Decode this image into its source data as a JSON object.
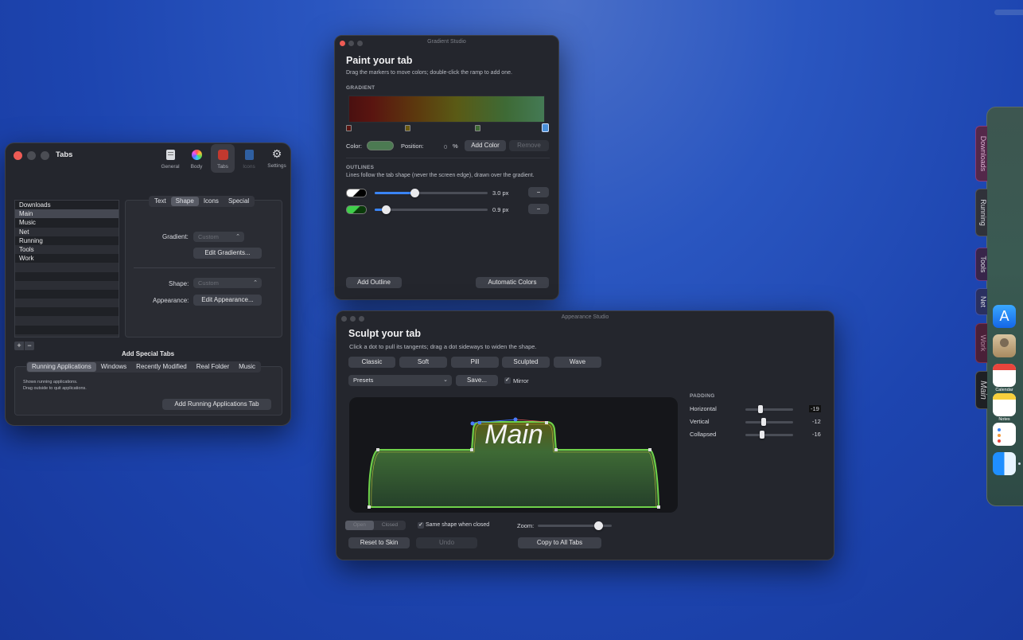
{
  "tabs_window": {
    "title": "Tabs",
    "toolbar": [
      {
        "label": "General",
        "icon": "general-icon"
      },
      {
        "label": "Body",
        "icon": "color-wheel-icon"
      },
      {
        "label": "Tabs",
        "icon": "tabs-icon"
      },
      {
        "label": "Icons",
        "icon": "icons-icon"
      },
      {
        "label": "Settings",
        "icon": "gear-icon"
      }
    ],
    "tab_list": [
      "Downloads",
      "Main",
      "Music",
      "Net",
      "Running",
      "Tools",
      "Work"
    ],
    "segments": [
      "Text",
      "Shape",
      "Icons",
      "Special"
    ],
    "gradient_label": "Gradient:",
    "gradient_value": "Custom",
    "edit_gradients": "Edit Gradients...",
    "shape_label": "Shape:",
    "shape_value": "Custom",
    "appearance_label": "Appearance:",
    "edit_appearance": "Edit Appearance...",
    "plus": "+",
    "minus": "−",
    "add_special_title": "Add Special Tabs",
    "special_segments": [
      "Running Applications",
      "Windows",
      "Recently Modified",
      "Real Folder",
      "Music"
    ],
    "special_desc_1": "Shows running applications.",
    "special_desc_2": "Drag outside to quit applications.",
    "add_running_button": "Add Running Applications Tab"
  },
  "gradient_window": {
    "title": "Gradient Studio",
    "heading": "Paint your tab",
    "subtitle": "Drag the markers to move colors; double-click the ramp to add one.",
    "gradient_label": "GRADIENT",
    "color_label": "Color:",
    "position_label": "Position:",
    "position_value": "0",
    "percent": "%",
    "add_color": "Add Color",
    "remove": "Remove",
    "outlines_label": "OUTLINES",
    "outlines_desc": "Lines follow the tab shape (never the screen edge), drawn over the gradient.",
    "outlines": [
      {
        "value": "3.0 px",
        "level": 0.35
      },
      {
        "value": "0.9 px",
        "level": 0.1
      }
    ],
    "remove_symbol": "−",
    "add_outline": "Add Outline",
    "automatic_colors": "Automatic Colors",
    "colors": {
      "stop_red": "#5a1512",
      "stop_olive": "#6b5a10",
      "stop_green": "#3f6a35",
      "stop_blue": "#4a8fd8"
    }
  },
  "appearance_window": {
    "title": "Appearance Studio",
    "heading": "Sculpt your tab",
    "subtitle": "Click a dot to pull its tangents; drag a dot sideways to widen the shape.",
    "shapes": [
      "Classic",
      "Soft",
      "Pill",
      "Sculpted",
      "Wave"
    ],
    "presets": "Presets",
    "save": "Save...",
    "mirror": "Mirror",
    "preview_text": "Main",
    "padding_label": "PADDING",
    "padding": [
      {
        "label": "Horizontal",
        "value": "-19",
        "level": 0.32
      },
      {
        "label": "Vertical",
        "value": "-12",
        "level": 0.38
      },
      {
        "label": "Collapsed",
        "value": "-16",
        "level": 0.35
      }
    ],
    "state_segments": [
      "Open",
      "Closed"
    ],
    "same_shape": "Same shape when closed",
    "zoom_label": "Zoom:",
    "zoom_level": 0.82,
    "reset": "Reset to Skin",
    "undo": "Undo",
    "copy_all": "Copy to All Tabs"
  },
  "dock": {
    "tabs": [
      "Downloads",
      "Running",
      "Tools",
      "Net",
      "Work",
      "Main"
    ],
    "apps": [
      {
        "label": "",
        "icon": "app-store-icon"
      },
      {
        "label": "",
        "icon": "contacts-icon"
      },
      {
        "label": "Calendar",
        "icon": "calendar-icon"
      },
      {
        "label": "Notes",
        "icon": "notes-icon"
      },
      {
        "label": "",
        "icon": "reminders-icon"
      },
      {
        "label": "",
        "icon": "finder-icon"
      }
    ]
  }
}
